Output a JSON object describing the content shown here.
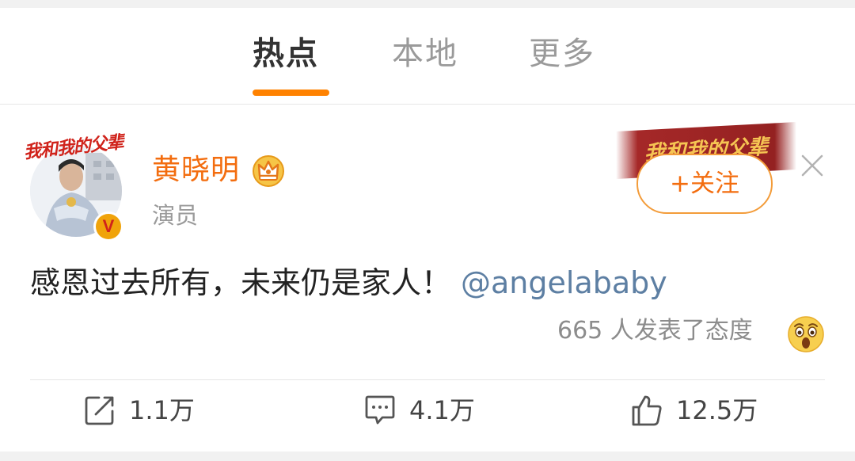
{
  "tabs": [
    {
      "label": "热点",
      "active": true
    },
    {
      "label": "本地",
      "active": false
    },
    {
      "label": "更多",
      "active": false
    }
  ],
  "post": {
    "avatar_banner_text": "我和我的父辈",
    "verified_badge": "V",
    "username": "黄晓明",
    "subtitle": "演员",
    "deco_banner_text": "我和我的父辈",
    "follow_label": "+关注",
    "text": "感恩过去所有，未来仍是家人！",
    "mention": "@angelababy",
    "reaction_summary": "665 人发表了态度",
    "reaction_icon": "surprised-face-icon"
  },
  "actions": {
    "repost": {
      "icon": "repost-icon",
      "count": "1.1万"
    },
    "comment": {
      "icon": "comment-icon",
      "count": "4.1万"
    },
    "like": {
      "icon": "thumbs-up-icon",
      "count": "12.5万"
    }
  },
  "colors": {
    "accent": "#ff8200",
    "username": "#f36d0f",
    "mention": "#5d7fa3",
    "muted": "#9a9a9a"
  }
}
